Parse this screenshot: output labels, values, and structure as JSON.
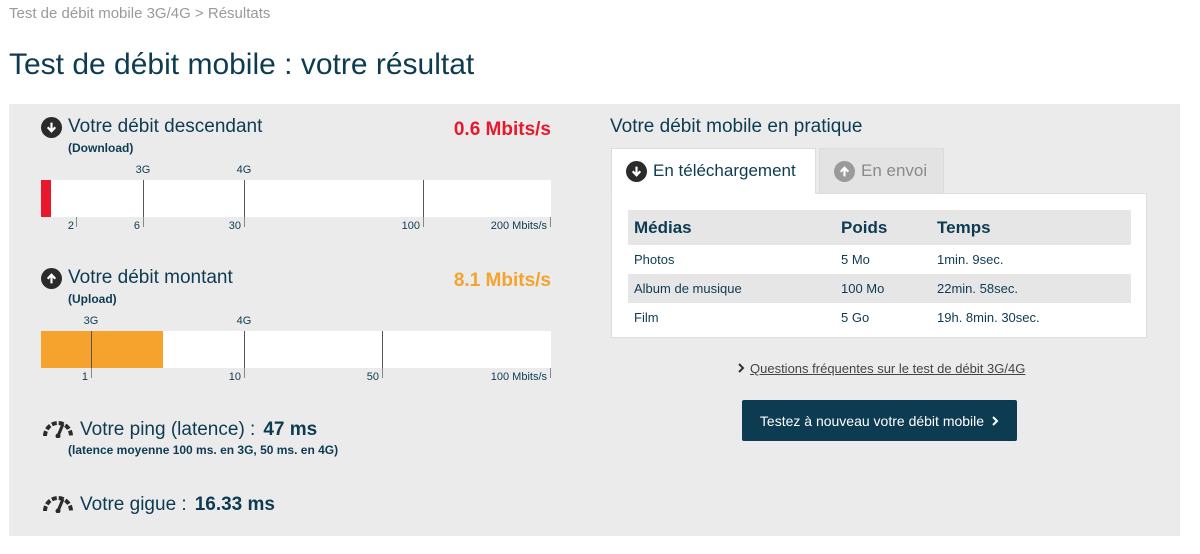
{
  "breadcrumb": "Test de débit mobile 3G/4G > Résultats",
  "page_title": "Test de débit mobile : votre résultat",
  "download": {
    "title": "Votre débit descendant",
    "subtitle": "(Download)",
    "value": "0.6 Mbits/s",
    "value_color": "#e8192c",
    "top_labels": [
      "3G",
      "4G"
    ],
    "scale_labels": [
      "2",
      "6",
      "30",
      "100",
      "200 Mbits/s"
    ],
    "fill_percent": 2,
    "fill_color": "#e8192c"
  },
  "upload": {
    "title": "Votre débit montant",
    "subtitle": "(Upload)",
    "value": "8.1 Mbits/s",
    "value_color": "#f5a32c",
    "top_labels": [
      "3G",
      "4G"
    ],
    "scale_labels": [
      "1",
      "10",
      "50",
      "100 Mbits/s"
    ],
    "fill_percent": 24,
    "fill_color": "#f5a32c"
  },
  "ping": {
    "title": "Votre ping (latence) :",
    "value": "47 ms",
    "note": "(latence moyenne 100 ms. en 3G, 50 ms. en 4G)"
  },
  "jitter": {
    "title": "Votre gigue :",
    "value": "16.33 ms"
  },
  "practice": {
    "title": "Votre débit mobile en pratique",
    "tabs": [
      {
        "label": "En téléchargement",
        "active": true
      },
      {
        "label": "En envoi",
        "active": false
      }
    ],
    "headers": [
      "Médias",
      "Poids",
      "Temps"
    ],
    "rows": [
      [
        "Photos",
        "5 Mo",
        "1min. 9sec."
      ],
      [
        "Album de musique",
        "100 Mo",
        "22min. 58sec."
      ],
      [
        "Film",
        "5 Go",
        "19h. 8min. 30sec."
      ]
    ]
  },
  "faq_link": "Questions fréquentes sur le test de débit 3G/4G",
  "cta_label": "Testez à nouveau votre débit mobile",
  "icons": {
    "download": "arrow-down-circle-icon",
    "upload": "arrow-up-circle-icon",
    "ping": "speedometer-icon",
    "jitter": "speedometer-icon",
    "chevron": "chevron-right-icon"
  }
}
